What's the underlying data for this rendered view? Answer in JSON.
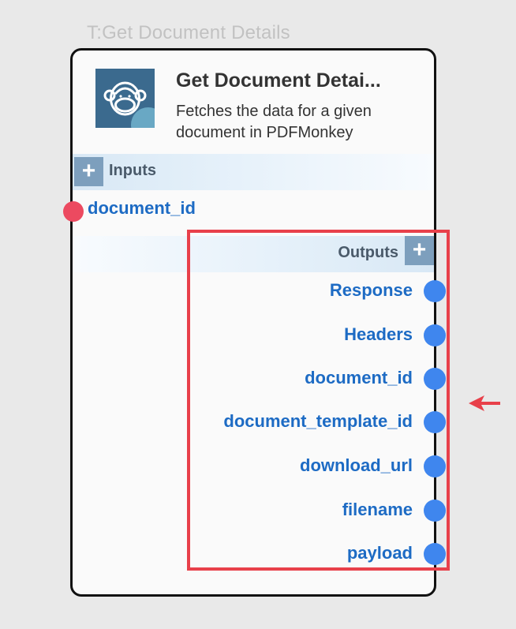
{
  "node": {
    "tag_title": "T:Get Document Details",
    "title": "Get Document Detai...",
    "description": "Fetches the data for a given document in PDFMonkey",
    "icon": "pdfmonkey-logo-icon"
  },
  "inputs": {
    "label": "Inputs",
    "add_label": "+",
    "items": [
      {
        "label": "document_id"
      }
    ]
  },
  "outputs": {
    "label": "Outputs",
    "add_label": "+",
    "items": [
      {
        "label": "Response"
      },
      {
        "label": "Headers"
      },
      {
        "label": "document_id"
      },
      {
        "label": "document_template_id"
      },
      {
        "label": "download_url"
      },
      {
        "label": "filename"
      },
      {
        "label": "payload"
      }
    ]
  },
  "colors": {
    "highlight": "#e8404a",
    "port_input": "#ec4a60",
    "port_output": "#3f86ee",
    "label": "#1d6bc4"
  }
}
